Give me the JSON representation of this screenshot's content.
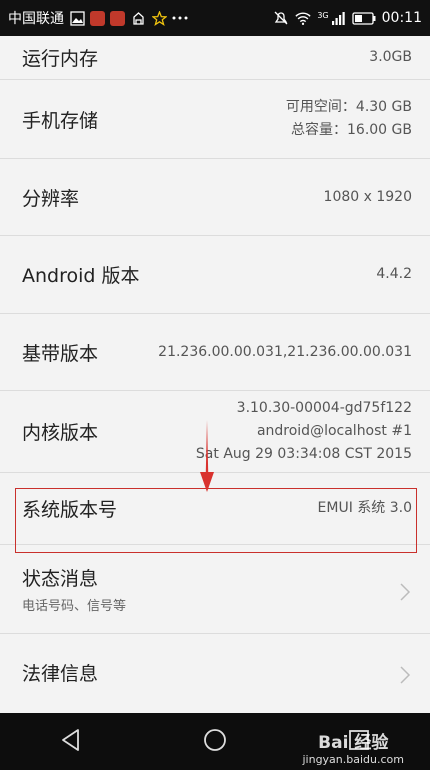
{
  "status_bar": {
    "carrier": "中国联通",
    "network": "3G",
    "time": "00:11",
    "icons": [
      "gallery-icon",
      "huawei-icon",
      "huawei-icon",
      "notification-icon",
      "star-icon",
      "more-icon",
      "mute-icon",
      "wifi-icon",
      "signal-icon",
      "battery-icon"
    ]
  },
  "rows": {
    "ram": {
      "label": "运行内存",
      "value": "3.0GB"
    },
    "storage": {
      "label": "手机存储",
      "value_line1": "可用空间：4.30 GB",
      "value_line2": "总容量：16.00 GB"
    },
    "resolution": {
      "label": "分辨率",
      "value": "1080 x 1920"
    },
    "android": {
      "label": "Android 版本",
      "value": "4.4.2"
    },
    "baseband": {
      "label": "基带版本",
      "value": "21.236.00.00.031,21.236.00.00.031"
    },
    "kernel": {
      "label": "内核版本",
      "value_line1": "3.10.30-00004-gd75f122",
      "value_line2": "android@localhost #1",
      "value_line3": "Sat Aug 29 03:34:08 CST 2015"
    },
    "system": {
      "label": "系统版本号",
      "value": "EMUI 系统 3.0"
    },
    "status": {
      "label": "状态消息",
      "sub": "电话号码、信号等"
    },
    "legal": {
      "label": "法律信息"
    }
  },
  "annotation": {
    "color": "#c9302c"
  },
  "watermark": {
    "main": "Bai 经验",
    "sub": "jingyan.baidu.com"
  }
}
